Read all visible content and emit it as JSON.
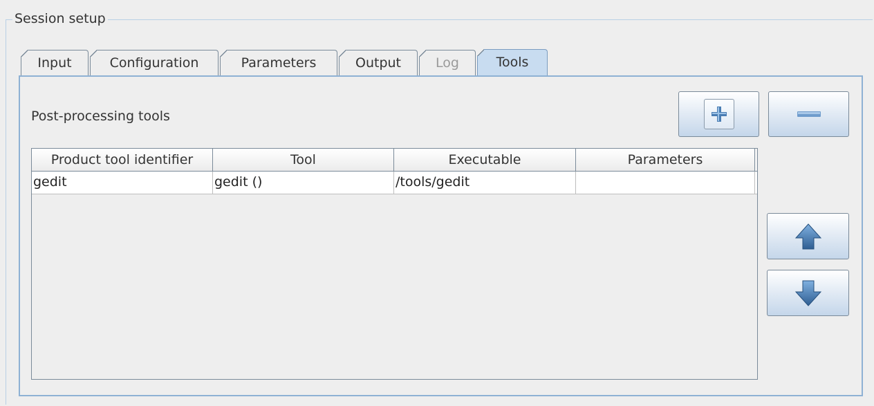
{
  "group": {
    "title": "Session setup"
  },
  "tabs": [
    {
      "label": "Input",
      "state": "normal"
    },
    {
      "label": "Configuration",
      "state": "normal"
    },
    {
      "label": "Parameters",
      "state": "normal"
    },
    {
      "label": "Output",
      "state": "normal"
    },
    {
      "label": "Log",
      "state": "disabled"
    },
    {
      "label": "Tools",
      "state": "selected"
    }
  ],
  "tools_panel": {
    "heading": "Post-processing tools",
    "buttons": {
      "add_icon": "plus-icon",
      "remove_icon": "minus-icon",
      "move_up_icon": "arrow-up-icon",
      "move_down_icon": "arrow-down-icon"
    },
    "table": {
      "columns": [
        "Product tool identifier",
        "Tool",
        "Executable",
        "Parameters"
      ],
      "rows": [
        [
          "gedit",
          "gedit ()",
          "/tools/gedit",
          ""
        ]
      ]
    }
  },
  "colors": {
    "selected_tab": "#c8dcf0",
    "panel_border": "#8eb1d4",
    "icon_blue": "#3f6fa3"
  }
}
